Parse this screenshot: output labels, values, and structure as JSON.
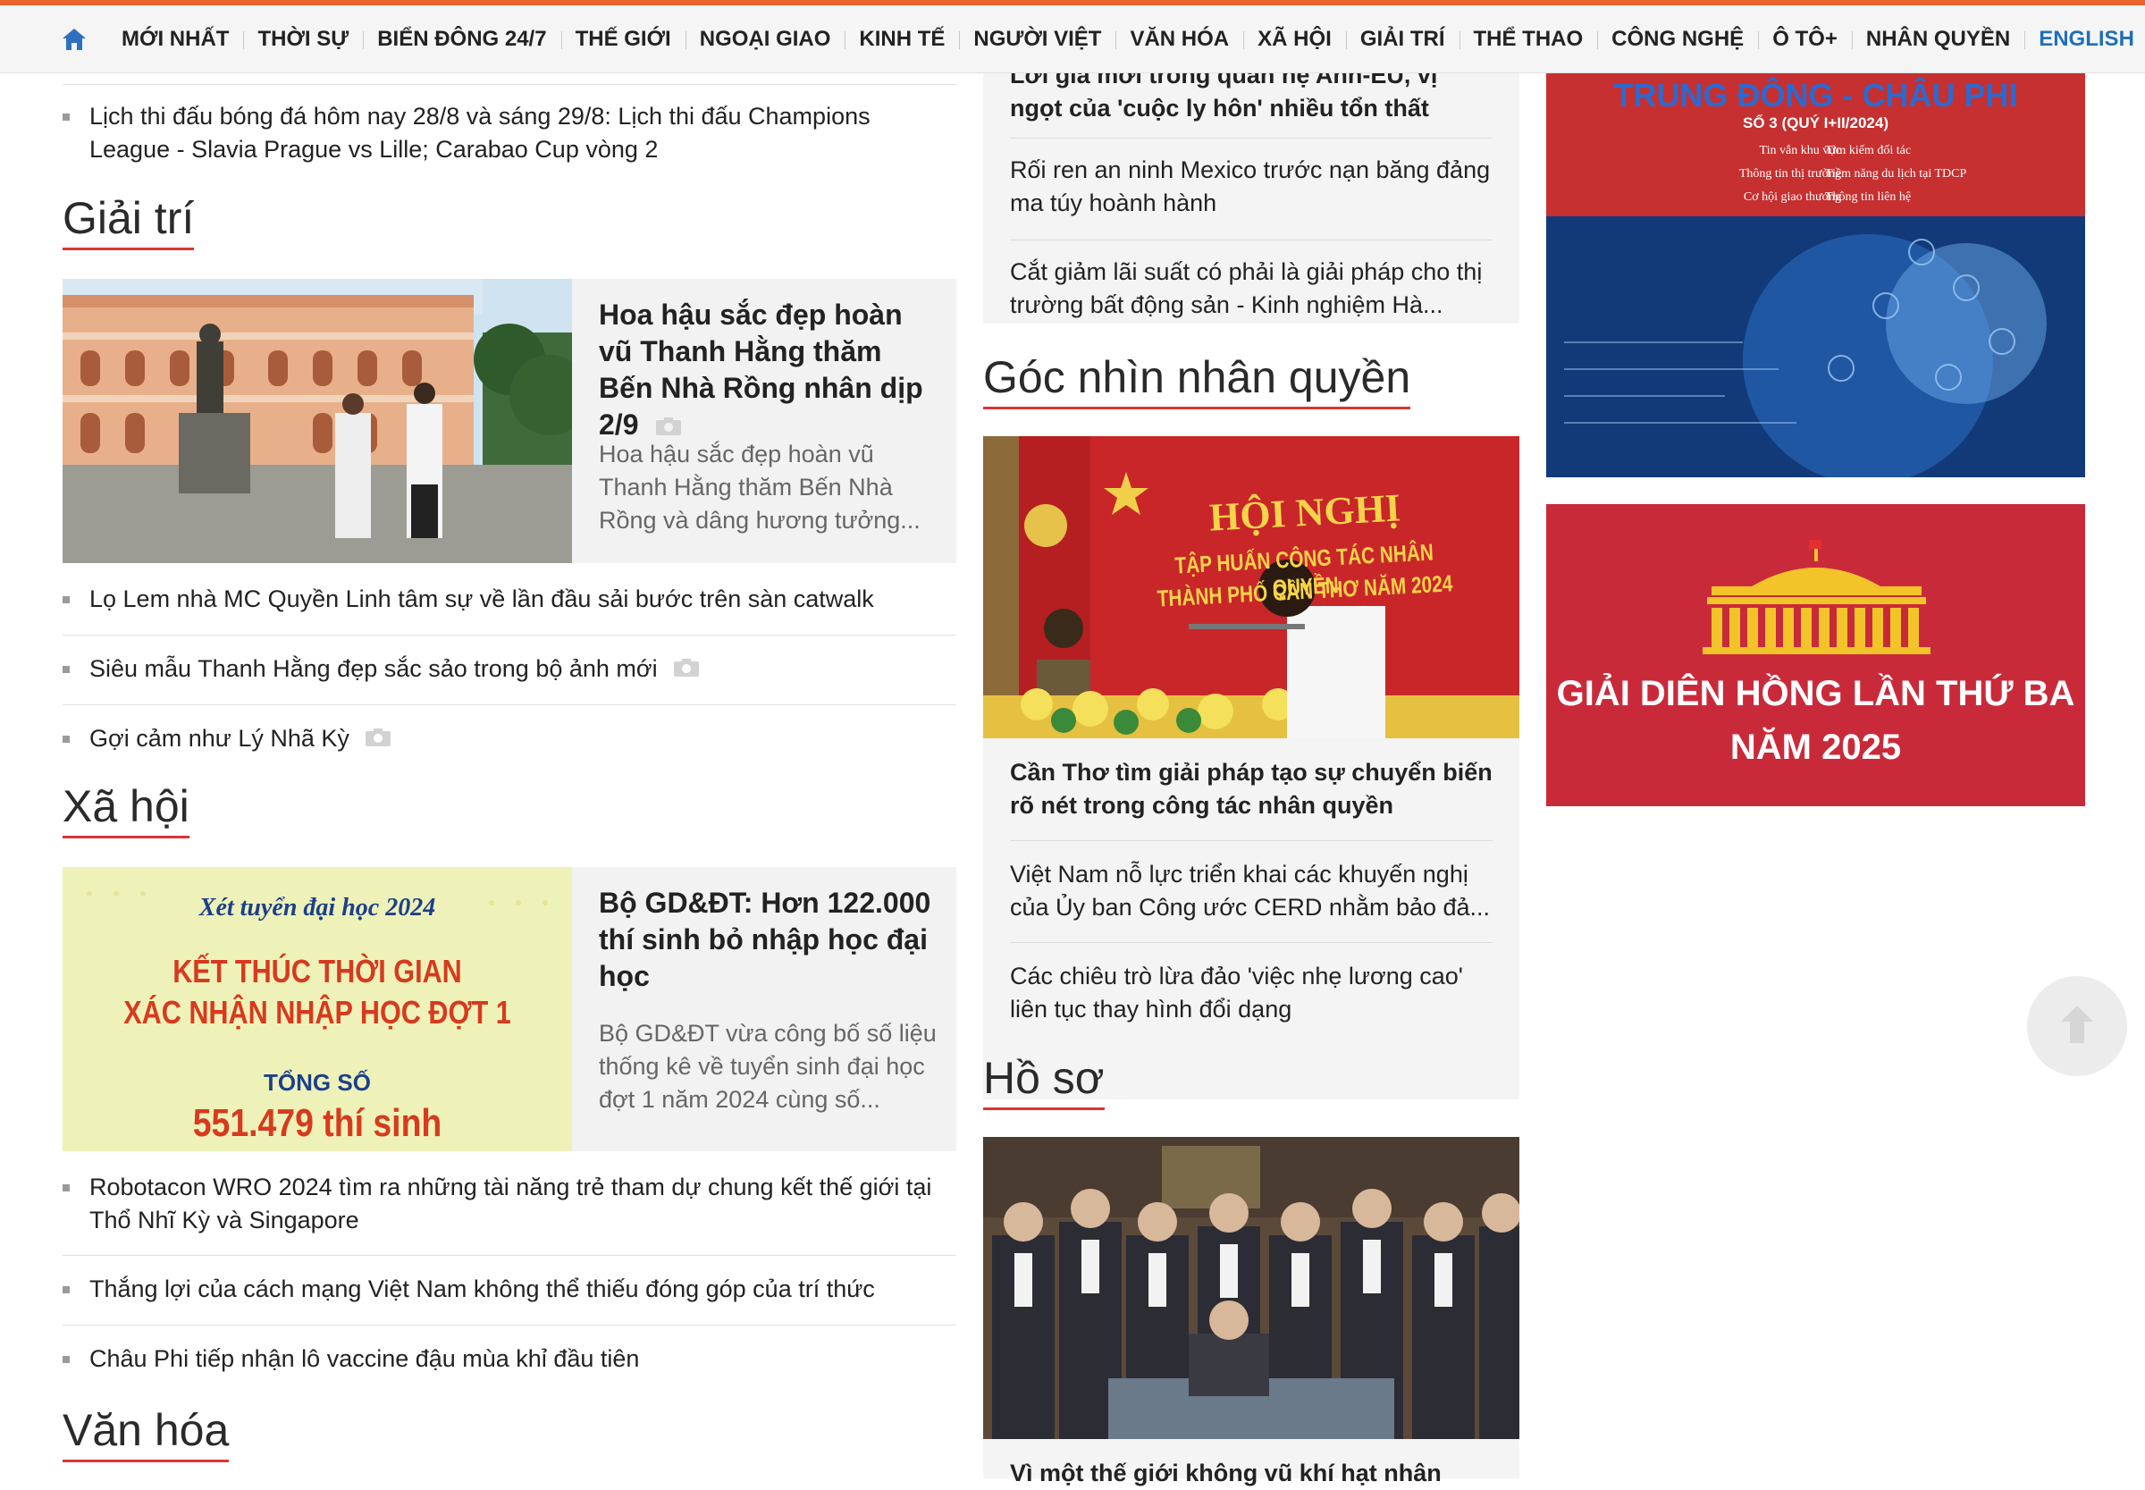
{
  "nav": {
    "home_icon": "home-icon",
    "items": [
      "MỚI NHẤT",
      "THỜI SỰ",
      "BIỂN ĐÔNG 24/7",
      "THẾ GIỚI",
      "NGOẠI GIAO",
      "KINH TẾ",
      "NGƯỜI VIỆT",
      "VĂN HÓA",
      "XÃ HỘI",
      "GIẢI TRÍ",
      "THỂ THAO",
      "CÔNG NGHỆ",
      "Ô TÔ+",
      "NHÂN QUYỀN"
    ],
    "english": "ENGLISH",
    "accent": "#e8642a"
  },
  "left": {
    "top_item": "Lịch thi đấu bóng đá hôm nay 28/8 và sáng 29/8: Lịch thi đấu Champions League - Slavia Prague vs Lille; Carabao Cup vòng 2",
    "giaitri": {
      "title": "Giải trí",
      "feature_title": "Hoa hậu sắc đẹp hoàn vũ Thanh Hằng thăm Bến Nhà Rồng nhân dịp 2/9",
      "feature_summary": "Hoa hậu sắc đẹp hoàn vũ Thanh Hằng thăm Bến Nhà Rồng và dâng hương tưởng...",
      "items": [
        "Lọ Lem nhà MC Quyền Linh tâm sự về lần đầu sải bước trên sàn catwalk",
        "Siêu mẫu Thanh Hằng đẹp sắc sảo trong bộ ảnh mới",
        "Gợi cảm như Lý Nhã Kỳ"
      ]
    },
    "xahoi": {
      "title": "Xã hội",
      "feature_title": "Bộ GD&ĐT: Hơn 122.000 thí sinh bỏ nhập học đại học",
      "feature_summary": "Bộ GD&ĐT vừa công bố số liệu thống kê về tuyển sinh đại học đợt 1 năm 2024 cùng số...",
      "image_text": {
        "line1": "Xét tuyển đại học 2024",
        "line2": "KẾT THÚC THỜI GIAN",
        "line3": "XÁC NHẬN NHẬP HỌC ĐỢT 1",
        "line4": "TỔNG SỐ",
        "line5": "551.479 thí sinh"
      },
      "items": [
        "Robotacon WRO 2024 tìm ra những tài năng trẻ tham dự chung kết thế giới tại Thổ Nhĩ Kỳ và Singapore",
        "Thắng lợi của cách mạng Việt Nam không thể thiếu đóng góp của trí thức",
        "Châu Phi tiếp nhận lô vaccine đậu mùa khỉ đầu tiên"
      ]
    },
    "vanhoa": {
      "title": "Văn hóa"
    }
  },
  "mid": {
    "top_box": {
      "items": [
        "Lời giả mới trong quan hệ Anh-EU, vị ngọt của 'cuộc ly hôn' nhiều tổn thất",
        "Rối ren an ninh Mexico trước nạn băng đảng ma túy hoành hành",
        "Cắt giảm lãi suất có phải là giải pháp cho thị trường bất động sản - Kinh nghiệm Hà..."
      ]
    },
    "nhanquyen": {
      "title": "Góc nhìn nhân quyền",
      "image_text": {
        "banner": "HỘI NGHỊ",
        "sub1": "TẬP HUẤN CÔNG TÁC NHÂN QUYỀN",
        "sub2": "THÀNH PHỐ CẦN THƠ NĂM 2024"
      },
      "items": [
        "Cần Thơ tìm giải pháp tạo sự chuyển biến rõ nét trong công tác nhân quyền",
        "Việt Nam nỗ lực triển khai các khuyến nghị của Ủy ban Công ước CERD nhằm bảo đả...",
        "Các chiêu trò lừa đảo 'việc nhẹ lương cao' liên tục thay hình đổi dạng"
      ]
    },
    "hoso": {
      "title": "Hồ sơ",
      "item": "Vì một thế giới không vũ khí hạt nhân"
    }
  },
  "right": {
    "ad1": {
      "title": "TRUNG ĐÔNG - CHÂU PHI",
      "issue": "SỐ 3 (QUÝ I+II/2024)",
      "bullets_left": [
        "Tin vắn khu vực",
        "Thông tin thị trường",
        "Cơ hội giao thương"
      ],
      "bullets_right": [
        "Tìm kiếm đối tác",
        "Tiềm năng du lịch tại TDCP",
        "Thông tin liên hệ"
      ]
    },
    "ad2": {
      "line1": "GIẢI DIÊN HỒNG LẦN THỨ BA",
      "line2": "NĂM 2025"
    }
  },
  "scroll_top_icon": "arrow-up-icon"
}
